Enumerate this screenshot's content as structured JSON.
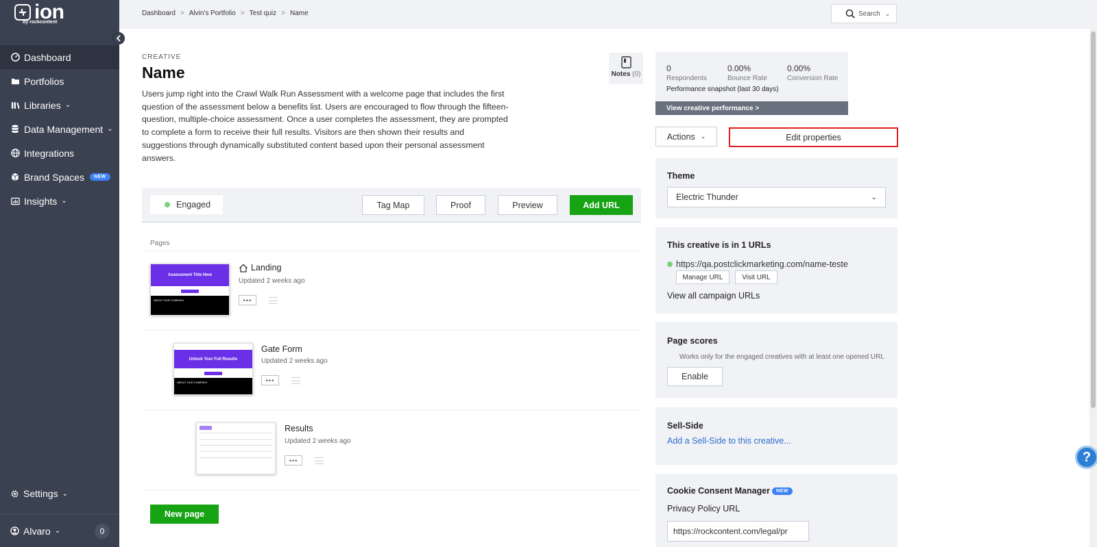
{
  "app": {
    "logo_text": "ion",
    "logo_sub": "by rockcontent"
  },
  "sidebar": {
    "items": [
      {
        "label": "Dashboard",
        "icon": "dashboard-icon",
        "active": true
      },
      {
        "label": "Portfolios",
        "icon": "folder-icon"
      },
      {
        "label": "Libraries",
        "icon": "library-icon",
        "has_chevron": true
      },
      {
        "label": "Data Management",
        "icon": "database-icon",
        "has_chevron": true
      },
      {
        "label": "Integrations",
        "icon": "globe-icon"
      },
      {
        "label": "Brand Spaces",
        "icon": "cube-icon",
        "badge": "NEW"
      },
      {
        "label": "Insights",
        "icon": "chart-icon",
        "has_chevron": true
      }
    ],
    "settings_label": "Settings",
    "user_name": "Alvaro",
    "notification_count": "0"
  },
  "breadcrumb": [
    "Dashboard",
    "Alvin's Portfolio",
    "Test quiz",
    "Name"
  ],
  "search": {
    "label": "Search"
  },
  "creative": {
    "category": "CREATIVE",
    "title": "Name",
    "description": "Users jump right into the Crawl Walk Run Assessment with a welcome page that includes the first question of the assessment below a benefits list. Users are encouraged to flow through the fifteen-question, multiple-choice assessment. Once a user completes the assessment, they are prompted to complete a form to receive their full results. Visitors are then shown their results and suggestions through dynamically substituted content based upon their personal assessment answers.",
    "notes_label": "Notes",
    "notes_count": "(0)"
  },
  "toolbar": {
    "status": "Engaged",
    "tag_map": "Tag Map",
    "proof": "Proof",
    "preview": "Preview",
    "add_url": "Add URL"
  },
  "pages": {
    "label": "Pages",
    "items": [
      {
        "name": "Landing",
        "updated": "Updated 2 weeks ago",
        "thumb_title": "Assessment Title Here",
        "thumb_footer": "ABOUT OUR COMPANY"
      },
      {
        "name": "Gate Form",
        "updated": "Updated 2 weeks ago",
        "thumb_title": "Unlock Your Full Results",
        "thumb_footer": "ABOUT OUR COMPANY"
      },
      {
        "name": "Results",
        "updated": "Updated 2 weeks ago"
      }
    ],
    "more_label": "•••",
    "new_page": "New page"
  },
  "performance": {
    "stats": [
      {
        "value": "0",
        "label": "Respondents"
      },
      {
        "value": "0.00%",
        "label": "Bounce Rate"
      },
      {
        "value": "0.00%",
        "label": "Conversion Rate"
      }
    ],
    "snapshot": "Performance snapshot (last 30 days)",
    "view_link": "View creative performance >"
  },
  "actions": {
    "actions_label": "Actions",
    "edit_properties": "Edit properties"
  },
  "theme": {
    "heading": "Theme",
    "selected": "Electric Thunder"
  },
  "urls": {
    "heading": "This creative is in 1 URLs",
    "url": "https://qa.postclickmarketing.com/name-teste",
    "manage": "Manage URL",
    "visit": "Visit URL",
    "view_all": "View all campaign URLs"
  },
  "page_scores": {
    "heading": "Page scores",
    "note": "Works only for the engaged creatives with at least one opened URL",
    "enable": "Enable"
  },
  "sell_side": {
    "heading": "Sell-Side",
    "link": "Add a Sell-Side to this creative..."
  },
  "cookie": {
    "heading": "Cookie Consent Manager",
    "badge": "NEW",
    "privacy_label": "Privacy Policy URL",
    "privacy_value": "https://rockcontent.com/legal/pr"
  },
  "help": {
    "label": "?"
  },
  "colors": {
    "sidebar": "#3a4150",
    "accent_green": "#16a314",
    "link_blue": "#2f6fc9",
    "highlight_red": "#e02020",
    "thumb_purple": "#6a2fe6"
  }
}
